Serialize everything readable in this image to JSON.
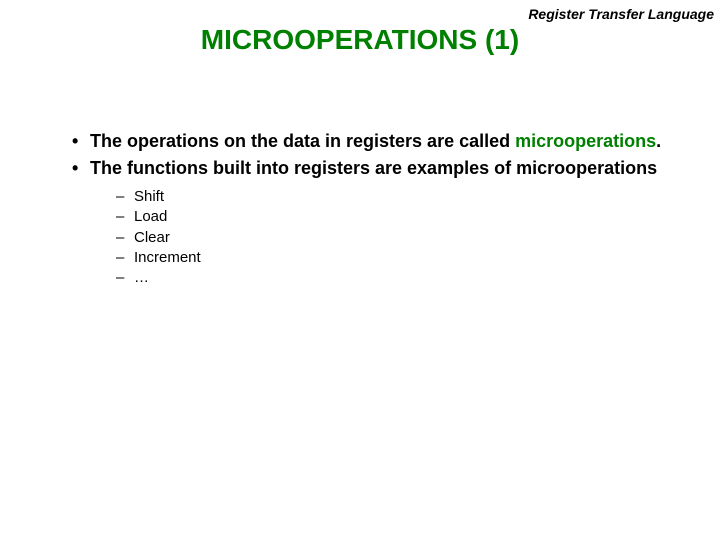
{
  "header": {
    "topic": "Register Transfer Language"
  },
  "title": "MICROOPERATIONS (1)",
  "bullets": {
    "b1_pre": "The operations on the data in registers are called ",
    "b1_keyword": "microoperations",
    "b1_post": ".",
    "b2": "The functions built into registers are examples of microoperations"
  },
  "sub": {
    "s1": "Shift",
    "s2": "Load",
    "s3": "Clear",
    "s4": "Increment",
    "s5": "…"
  },
  "markers": {
    "dot": "•",
    "dash": "–"
  }
}
